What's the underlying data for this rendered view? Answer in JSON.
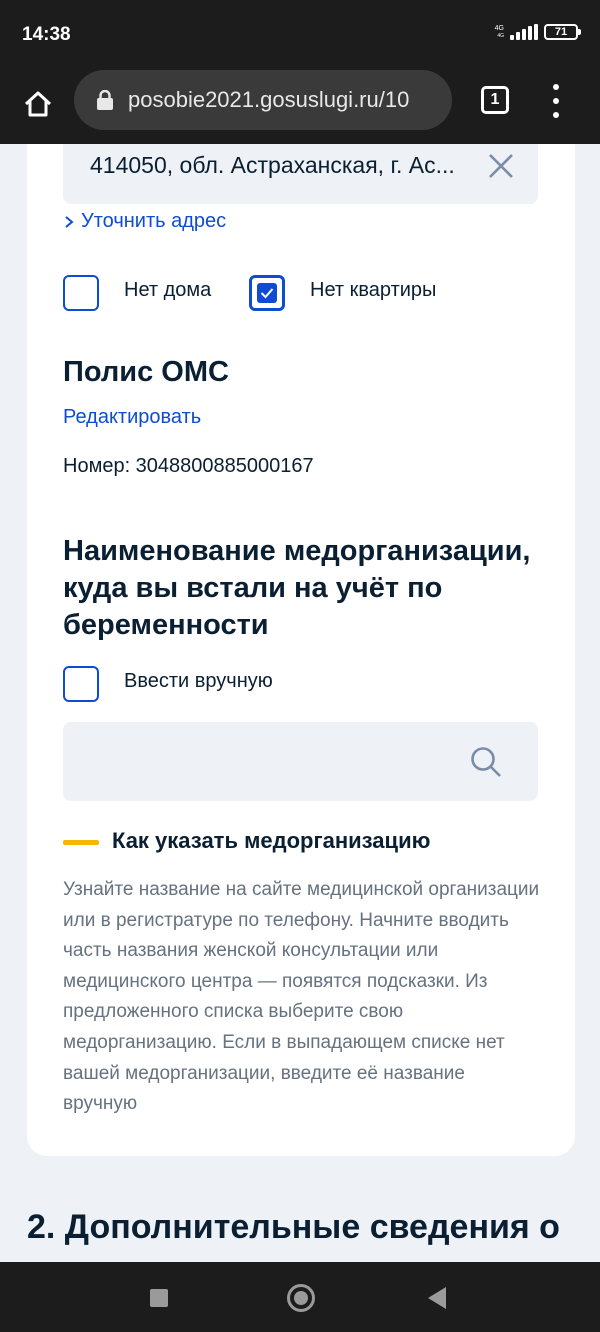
{
  "status_bar": {
    "time": "14:38",
    "network": "4G",
    "network_sub": "4G",
    "battery": "71"
  },
  "browser": {
    "url": "posobie2021.gosuslugi.ru/10",
    "tab_count": "1"
  },
  "address": {
    "value": "414050, обл. Астраханская, г. Ас...",
    "refine_link": "Уточнить адрес",
    "no_house": {
      "label": "Нет дома",
      "checked": false
    },
    "no_flat": {
      "label": "Нет квартиры",
      "checked": true
    }
  },
  "polis": {
    "title": "Полис ОМС",
    "edit_link": "Редактировать",
    "number": "Номер: 3048800885000167"
  },
  "med": {
    "title": "Наименование медорганизации, куда вы встали на учёт по беременности",
    "manual": {
      "label": "Ввести вручную",
      "checked": false
    },
    "search_value": ""
  },
  "hint": {
    "title": "Как указать медорганизацию",
    "body": "Узнайте название на сайте медицинской организации или в регистратуре по телефону. Начните вводить часть названия женской консультации или медицинского центра — появятся подсказки. Из предложенного списка выберите свою медорганизацию. Если в выпадающем списке нет вашей медорганизации, введите её название вручную",
    "accent_color": "#f5b700"
  },
  "section_2": {
    "title": "2. Дополнительные сведения о"
  },
  "colors": {
    "link": "#0d4cd3",
    "text": "#0b1f33",
    "muted": "#66727f",
    "page_bg": "#eef2f7",
    "field_bg": "#eef1f5"
  },
  "icons": [
    "home-icon",
    "lock-icon",
    "more-vert-icon",
    "clear-icon",
    "chevron-right-icon",
    "check-icon",
    "search-icon",
    "nav-recents-icon",
    "nav-home-icon",
    "nav-back-icon"
  ]
}
